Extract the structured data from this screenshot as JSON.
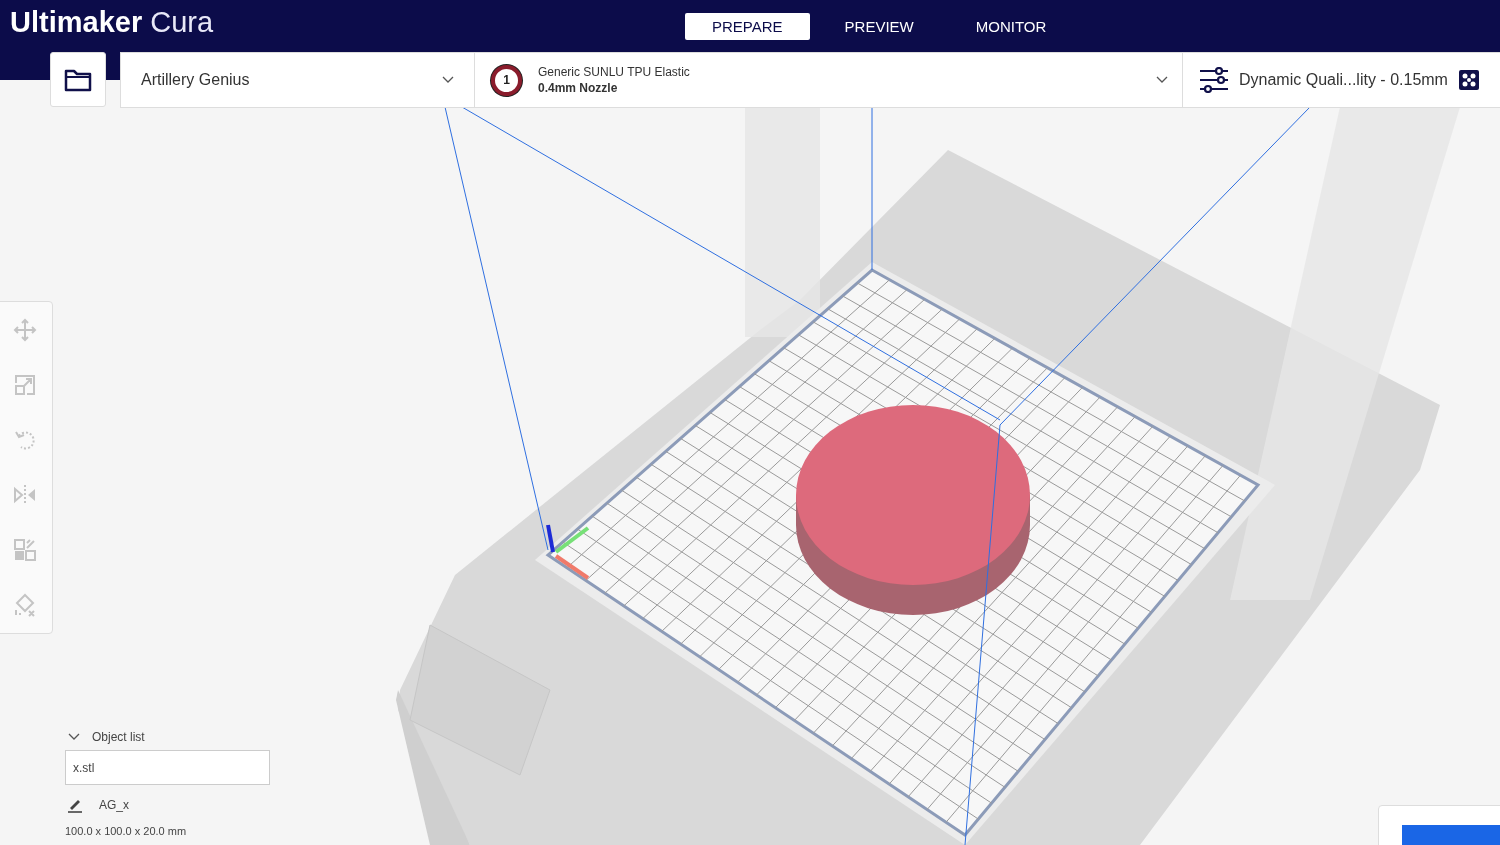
{
  "header": {
    "logo_bold": "Ultimaker",
    "logo_light": "Cura"
  },
  "stages": [
    {
      "label": "PREPARE",
      "selected": true
    },
    {
      "label": "PREVIEW",
      "selected": false
    },
    {
      "label": "MONITOR",
      "selected": false
    }
  ],
  "toolbar": {
    "printer": "Artillery Genius",
    "extruder": "1",
    "material": "Generic SUNLU TPU Elastic",
    "nozzle": "0.4mm Nozzle",
    "profile": "Dynamic Quali...lity - 0.15mm"
  },
  "object_list": {
    "title": "Object list",
    "expanded": true,
    "file": "x.stl",
    "object_name": "AG_x",
    "dimensions": "100.0 x 100.0 x 20.0 mm"
  }
}
